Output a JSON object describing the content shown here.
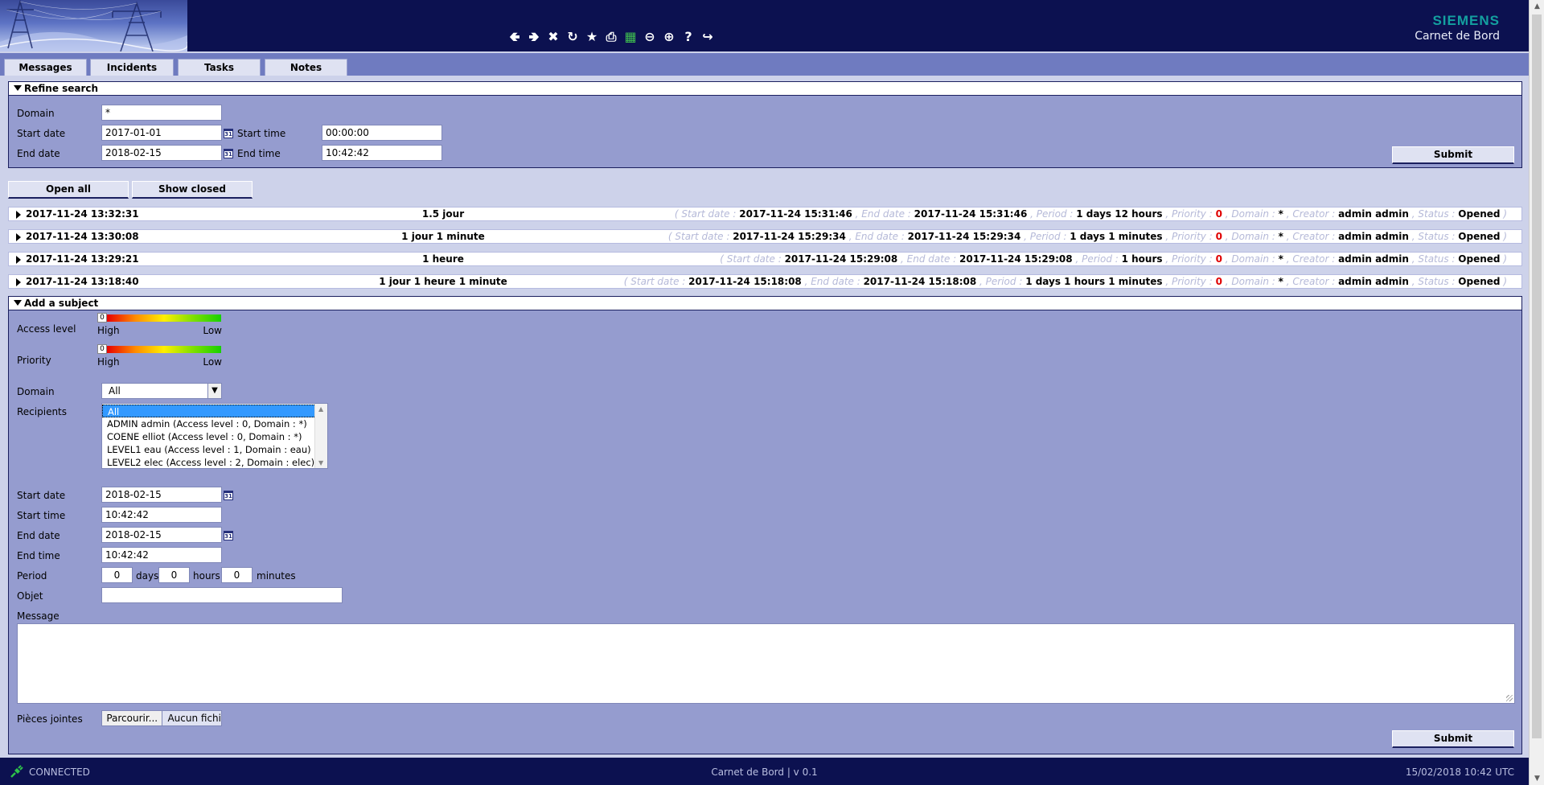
{
  "header": {
    "brand": "SIEMENS",
    "app_name": "Carnet de Bord",
    "toolbar_icons": [
      "arrow-left-icon",
      "arrow-right-icon",
      "close-circle-icon",
      "refresh-icon",
      "star-icon",
      "print-icon",
      "excel-icon",
      "zoom-out-icon",
      "zoom-in-icon",
      "help-icon",
      "logout-icon"
    ],
    "colors": {
      "header_bg": "#0c1150",
      "brand": "#14a0a0",
      "panel": "#959ccf"
    }
  },
  "tabs": [
    "Messages",
    "Incidents",
    "Tasks",
    "Notes"
  ],
  "refine": {
    "title": "Refine search",
    "domain_label": "Domain",
    "domain_value": "*",
    "start_date_label": "Start date",
    "start_date_value": "2017-01-01",
    "start_time_label": "Start time",
    "start_time_value": "00:00:00",
    "end_date_label": "End date",
    "end_date_value": "2018-02-15",
    "end_time_label": "End time",
    "end_time_value": "10:42:42",
    "submit": "Submit",
    "calendar_glyph": "31"
  },
  "actions": {
    "open_all": "Open all",
    "show_closed": "Show closed"
  },
  "rows": [
    {
      "date": "2017-11-24 13:32:31",
      "duration": "1.5 jour",
      "start": "2017-11-24 15:31:46",
      "end": "2017-11-24 15:31:46",
      "period": "1 days 12 hours",
      "priority": "0",
      "domain": "*",
      "creator": "admin admin",
      "status": "Opened"
    },
    {
      "date": "2017-11-24 13:30:08",
      "duration": "1 jour 1 minute",
      "start": "2017-11-24 15:29:34",
      "end": "2017-11-24 15:29:34",
      "period": "1 days 1 minutes",
      "priority": "0",
      "domain": "*",
      "creator": "admin admin",
      "status": "Opened"
    },
    {
      "date": "2017-11-24 13:29:21",
      "duration": "1 heure",
      "start": "2017-11-24 15:29:08",
      "end": "2017-11-24 15:29:08",
      "period": "1 hours",
      "priority": "0",
      "domain": "*",
      "creator": "admin admin",
      "status": "Opened"
    },
    {
      "date": "2017-11-24 13:18:40",
      "duration": "1 jour 1 heure 1 minute",
      "start": "2017-11-24 15:18:08",
      "end": "2017-11-24 15:18:08",
      "period": "1 days 1 hours 1 minutes",
      "priority": "0",
      "domain": "*",
      "creator": "admin admin",
      "status": "Opened"
    }
  ],
  "row_labels": {
    "open_paren": "( Start date : ",
    "end_date": " , End date : ",
    "period": " , Period : ",
    "priority": " , Priority : ",
    "domain": " , Domain : ",
    "creator": " , Creator : ",
    "status": " , Status : ",
    "close_paren": " )"
  },
  "add": {
    "title": "Add a subject",
    "access_label": "Access level",
    "access_value": "0",
    "priority_label": "Priority",
    "priority_value": "0",
    "high": "High",
    "low": "Low",
    "domain_label": "Domain",
    "domain_value": "All",
    "recipients_label": "Recipients",
    "recipients": [
      "All",
      "ADMIN admin (Access level : 0, Domain : *)",
      "COENE elliot (Access level : 0, Domain : *)",
      "LEVEL1 eau (Access level : 1, Domain : eau)",
      "LEVEL2 elec (Access level : 2, Domain : elec)"
    ],
    "start_date_label": "Start date",
    "start_date_value": "2018-02-15",
    "start_time_label": "Start time",
    "start_time_value": "10:42:42",
    "end_date_label": "End date",
    "end_date_value": "2018-02-15",
    "end_time_label": "End time",
    "end_time_value": "10:42:42",
    "period_label": "Period",
    "days_value": "0",
    "days_label": "days",
    "hours_value": "0",
    "hours_label": "hours",
    "minutes_value": "0",
    "minutes_label": "minutes",
    "objet_label": "Objet",
    "objet_value": "",
    "message_label": "Message",
    "attachments_label": "Pièces jointes",
    "browse": "Parcourir...",
    "no_file": "Aucun fichi",
    "submit": "Submit"
  },
  "footer": {
    "status": "CONNECTED",
    "version": "Carnet de Bord | v 0.1",
    "datetime": "15/02/2018 10:42 UTC"
  }
}
